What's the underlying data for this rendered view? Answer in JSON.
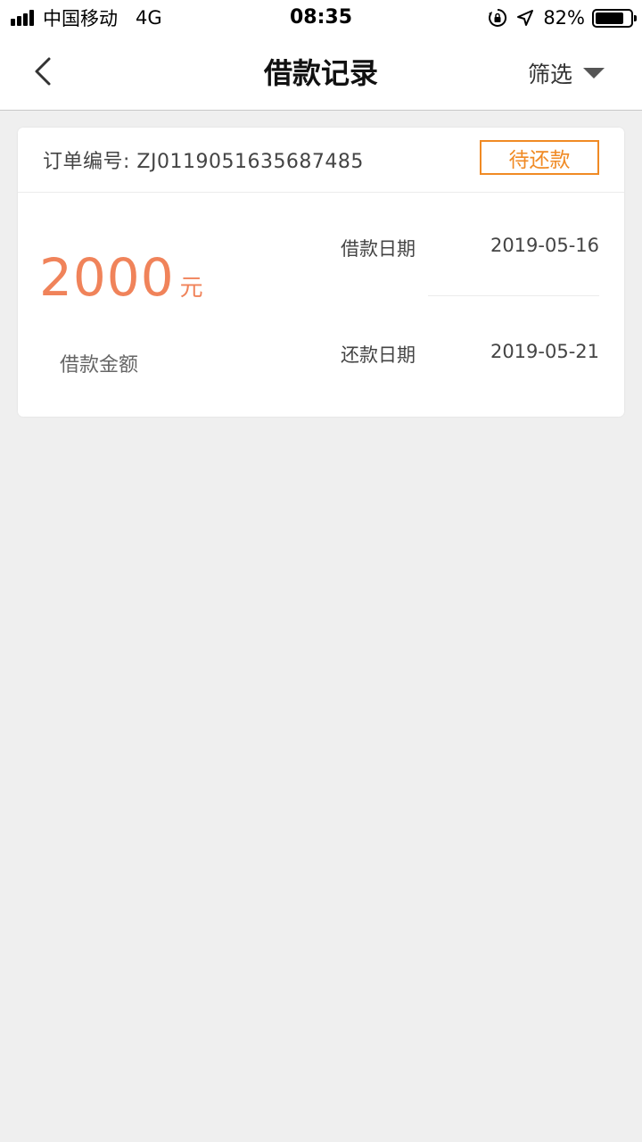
{
  "status_bar": {
    "carrier": "中国移动",
    "network": "4G",
    "time": "08:35",
    "battery_percent": "82%",
    "battery_level": 0.82,
    "icons": [
      "signal-icon",
      "rotation-lock-icon",
      "location-arrow-icon",
      "battery-icon"
    ]
  },
  "nav": {
    "title": "借款记录",
    "filter_label": "筛选",
    "icons": [
      "back-chevron-icon",
      "dropdown-triangle-icon"
    ]
  },
  "records": [
    {
      "order_number": "订单编号: ZJ0119051635687485",
      "status": "待还款",
      "amount": "2000",
      "amount_unit": "元",
      "amount_label": "借款金额",
      "loan_date_label": "借款日期",
      "loan_date": "2019-05-16",
      "repay_date_label": "还款日期",
      "repay_date": "2019-05-21"
    }
  ],
  "colors": {
    "accent_orange": "#f08a24",
    "amount_orange": "#f0835a",
    "background": "#efefef"
  }
}
